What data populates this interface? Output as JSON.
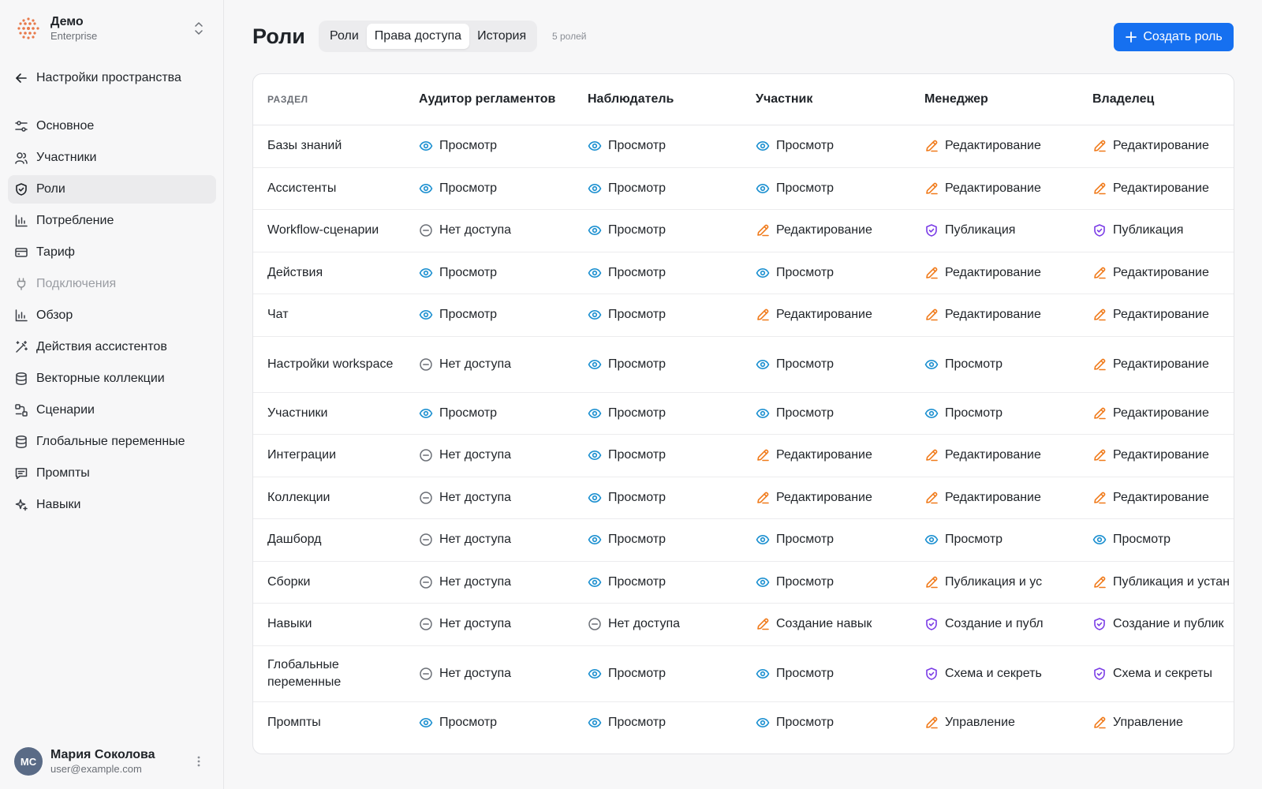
{
  "workspace": {
    "name": "Демо",
    "plan": "Enterprise"
  },
  "sidebar": {
    "back_label": "Настройки пространства",
    "items": [
      {
        "label": "Основное",
        "icon": "sliders-icon",
        "state": "normal"
      },
      {
        "label": "Участники",
        "icon": "users-icon",
        "state": "normal"
      },
      {
        "label": "Роли",
        "icon": "shield-icon",
        "state": "active"
      },
      {
        "label": "Потребление",
        "icon": "bar-chart-icon",
        "state": "normal"
      },
      {
        "label": "Тариф",
        "icon": "credit-card-icon",
        "state": "normal"
      },
      {
        "label": "Подключения",
        "icon": "plug-icon",
        "state": "disabled"
      },
      {
        "label": "Обзор",
        "icon": "bar-chart-icon",
        "state": "normal"
      },
      {
        "label": "Действия ассистентов",
        "icon": "magic-wand-icon",
        "state": "normal"
      },
      {
        "label": "Векторные коллекции",
        "icon": "database-icon",
        "state": "normal"
      },
      {
        "label": "Сценарии",
        "icon": "workflow-icon",
        "state": "normal"
      },
      {
        "label": "Глобальные переменные",
        "icon": "database-icon",
        "state": "normal"
      },
      {
        "label": "Промпты",
        "icon": "message-icon",
        "state": "normal"
      },
      {
        "label": "Навыки",
        "icon": "sparkles-icon",
        "state": "normal"
      }
    ]
  },
  "user": {
    "initials": "МС",
    "name": "Мария Соколова",
    "email": "user@example.com"
  },
  "header": {
    "title": "Роли",
    "tabs": [
      {
        "label": "Роли",
        "active": false
      },
      {
        "label": "Права доступа",
        "active": true
      },
      {
        "label": "История",
        "active": false
      }
    ],
    "role_count": "5 ролей",
    "create_label": "Создать роль"
  },
  "colors": {
    "accent": "#1670f0",
    "view": "#1a8fd0",
    "edit": "#f07a1a",
    "publish": "#7a3ce6",
    "none": "#6b6f76"
  },
  "table": {
    "columns": [
      "РАЗДЕЛ",
      "Аудитор регламентов",
      "Наблюдатель",
      "Участник",
      "Менеджер",
      "Владелец"
    ],
    "rows": [
      {
        "section": "Базы знаний",
        "cells": [
          {
            "icon": "eye-icon",
            "text": "Просмотр"
          },
          {
            "icon": "eye-icon",
            "text": "Просмотр"
          },
          {
            "icon": "eye-icon",
            "text": "Просмотр"
          },
          {
            "icon": "pencil-icon",
            "text": "Редактирование"
          },
          {
            "icon": "pencil-icon",
            "text": "Редактирование"
          }
        ]
      },
      {
        "section": "Ассистенты",
        "cells": [
          {
            "icon": "eye-icon",
            "text": "Просмотр"
          },
          {
            "icon": "eye-icon",
            "text": "Просмотр"
          },
          {
            "icon": "eye-icon",
            "text": "Просмотр"
          },
          {
            "icon": "pencil-icon",
            "text": "Редактирование"
          },
          {
            "icon": "pencil-icon",
            "text": "Редактирование"
          }
        ]
      },
      {
        "section": "Workflow-сценарии",
        "cells": [
          {
            "icon": "minus-circle-icon",
            "text": "Нет доступа"
          },
          {
            "icon": "eye-icon",
            "text": "Просмотр"
          },
          {
            "icon": "pencil-icon",
            "text": "Редактирование"
          },
          {
            "icon": "shield-check-icon",
            "text": "Публикация"
          },
          {
            "icon": "shield-check-icon",
            "text": "Публикация"
          }
        ]
      },
      {
        "section": "Действия",
        "cells": [
          {
            "icon": "eye-icon",
            "text": "Просмотр"
          },
          {
            "icon": "eye-icon",
            "text": "Просмотр"
          },
          {
            "icon": "eye-icon",
            "text": "Просмотр"
          },
          {
            "icon": "pencil-icon",
            "text": "Редактирование"
          },
          {
            "icon": "pencil-icon",
            "text": "Редактирование"
          }
        ]
      },
      {
        "section": "Чат",
        "cells": [
          {
            "icon": "eye-icon",
            "text": "Просмотр"
          },
          {
            "icon": "eye-icon",
            "text": "Просмотр"
          },
          {
            "icon": "pencil-icon",
            "text": "Редактирование"
          },
          {
            "icon": "pencil-icon",
            "text": "Редактирование"
          },
          {
            "icon": "pencil-icon",
            "text": "Редактирование"
          }
        ]
      },
      {
        "section": "Настройки workspace",
        "cells": [
          {
            "icon": "minus-circle-icon",
            "text": "Нет доступа"
          },
          {
            "icon": "eye-icon",
            "text": "Просмотр"
          },
          {
            "icon": "eye-icon",
            "text": "Просмотр"
          },
          {
            "icon": "eye-icon",
            "text": "Просмотр"
          },
          {
            "icon": "pencil-icon",
            "text": "Редактирование"
          }
        ]
      },
      {
        "section": "Участники",
        "cells": [
          {
            "icon": "eye-icon",
            "text": "Просмотр"
          },
          {
            "icon": "eye-icon",
            "text": "Просмотр"
          },
          {
            "icon": "eye-icon",
            "text": "Просмотр"
          },
          {
            "icon": "eye-icon",
            "text": "Просмотр"
          },
          {
            "icon": "pencil-icon",
            "text": "Редактирование"
          }
        ]
      },
      {
        "section": "Интеграции",
        "cells": [
          {
            "icon": "minus-circle-icon",
            "text": "Нет доступа"
          },
          {
            "icon": "eye-icon",
            "text": "Просмотр"
          },
          {
            "icon": "pencil-icon",
            "text": "Редактирование"
          },
          {
            "icon": "pencil-icon",
            "text": "Редактирование"
          },
          {
            "icon": "pencil-icon",
            "text": "Редактирование"
          }
        ]
      },
      {
        "section": "Коллекции",
        "cells": [
          {
            "icon": "minus-circle-icon",
            "text": "Нет доступа"
          },
          {
            "icon": "eye-icon",
            "text": "Просмотр"
          },
          {
            "icon": "pencil-icon",
            "text": "Редактирование"
          },
          {
            "icon": "pencil-icon",
            "text": "Редактирование"
          },
          {
            "icon": "pencil-icon",
            "text": "Редактирование"
          }
        ]
      },
      {
        "section": "Дашборд",
        "cells": [
          {
            "icon": "minus-circle-icon",
            "text": "Нет доступа"
          },
          {
            "icon": "eye-icon",
            "text": "Просмотр"
          },
          {
            "icon": "eye-icon",
            "text": "Просмотр"
          },
          {
            "icon": "eye-icon",
            "text": "Просмотр"
          },
          {
            "icon": "eye-icon",
            "text": "Просмотр"
          }
        ]
      },
      {
        "section": "Сборки",
        "cells": [
          {
            "icon": "minus-circle-icon",
            "text": "Нет доступа"
          },
          {
            "icon": "eye-icon",
            "text": "Просмотр"
          },
          {
            "icon": "eye-icon",
            "text": "Просмотр"
          },
          {
            "icon": "pencil-icon",
            "text": "Публикация и ус"
          },
          {
            "icon": "pencil-icon",
            "text": "Публикация и устан"
          }
        ]
      },
      {
        "section": "Навыки",
        "cells": [
          {
            "icon": "minus-circle-icon",
            "text": "Нет доступа"
          },
          {
            "icon": "minus-circle-icon",
            "text": "Нет доступа"
          },
          {
            "icon": "pencil-icon",
            "text": "Создание навык"
          },
          {
            "icon": "shield-check-icon",
            "text": "Создание и публ"
          },
          {
            "icon": "shield-check-icon",
            "text": "Создание и публик"
          }
        ]
      },
      {
        "section": "Глобальные переменные",
        "cells": [
          {
            "icon": "minus-circle-icon",
            "text": "Нет доступа"
          },
          {
            "icon": "eye-icon",
            "text": "Просмотр"
          },
          {
            "icon": "eye-icon",
            "text": "Просмотр"
          },
          {
            "icon": "shield-check-icon",
            "text": "Схема и секреть"
          },
          {
            "icon": "shield-check-icon",
            "text": "Схема и секреты"
          }
        ]
      },
      {
        "section": "Промпты",
        "cells": [
          {
            "icon": "eye-icon",
            "text": "Просмотр"
          },
          {
            "icon": "eye-icon",
            "text": "Просмотр"
          },
          {
            "icon": "eye-icon",
            "text": "Просмотр"
          },
          {
            "icon": "pencil-icon",
            "text": "Управление"
          },
          {
            "icon": "pencil-icon",
            "text": "Управление"
          }
        ]
      }
    ]
  }
}
